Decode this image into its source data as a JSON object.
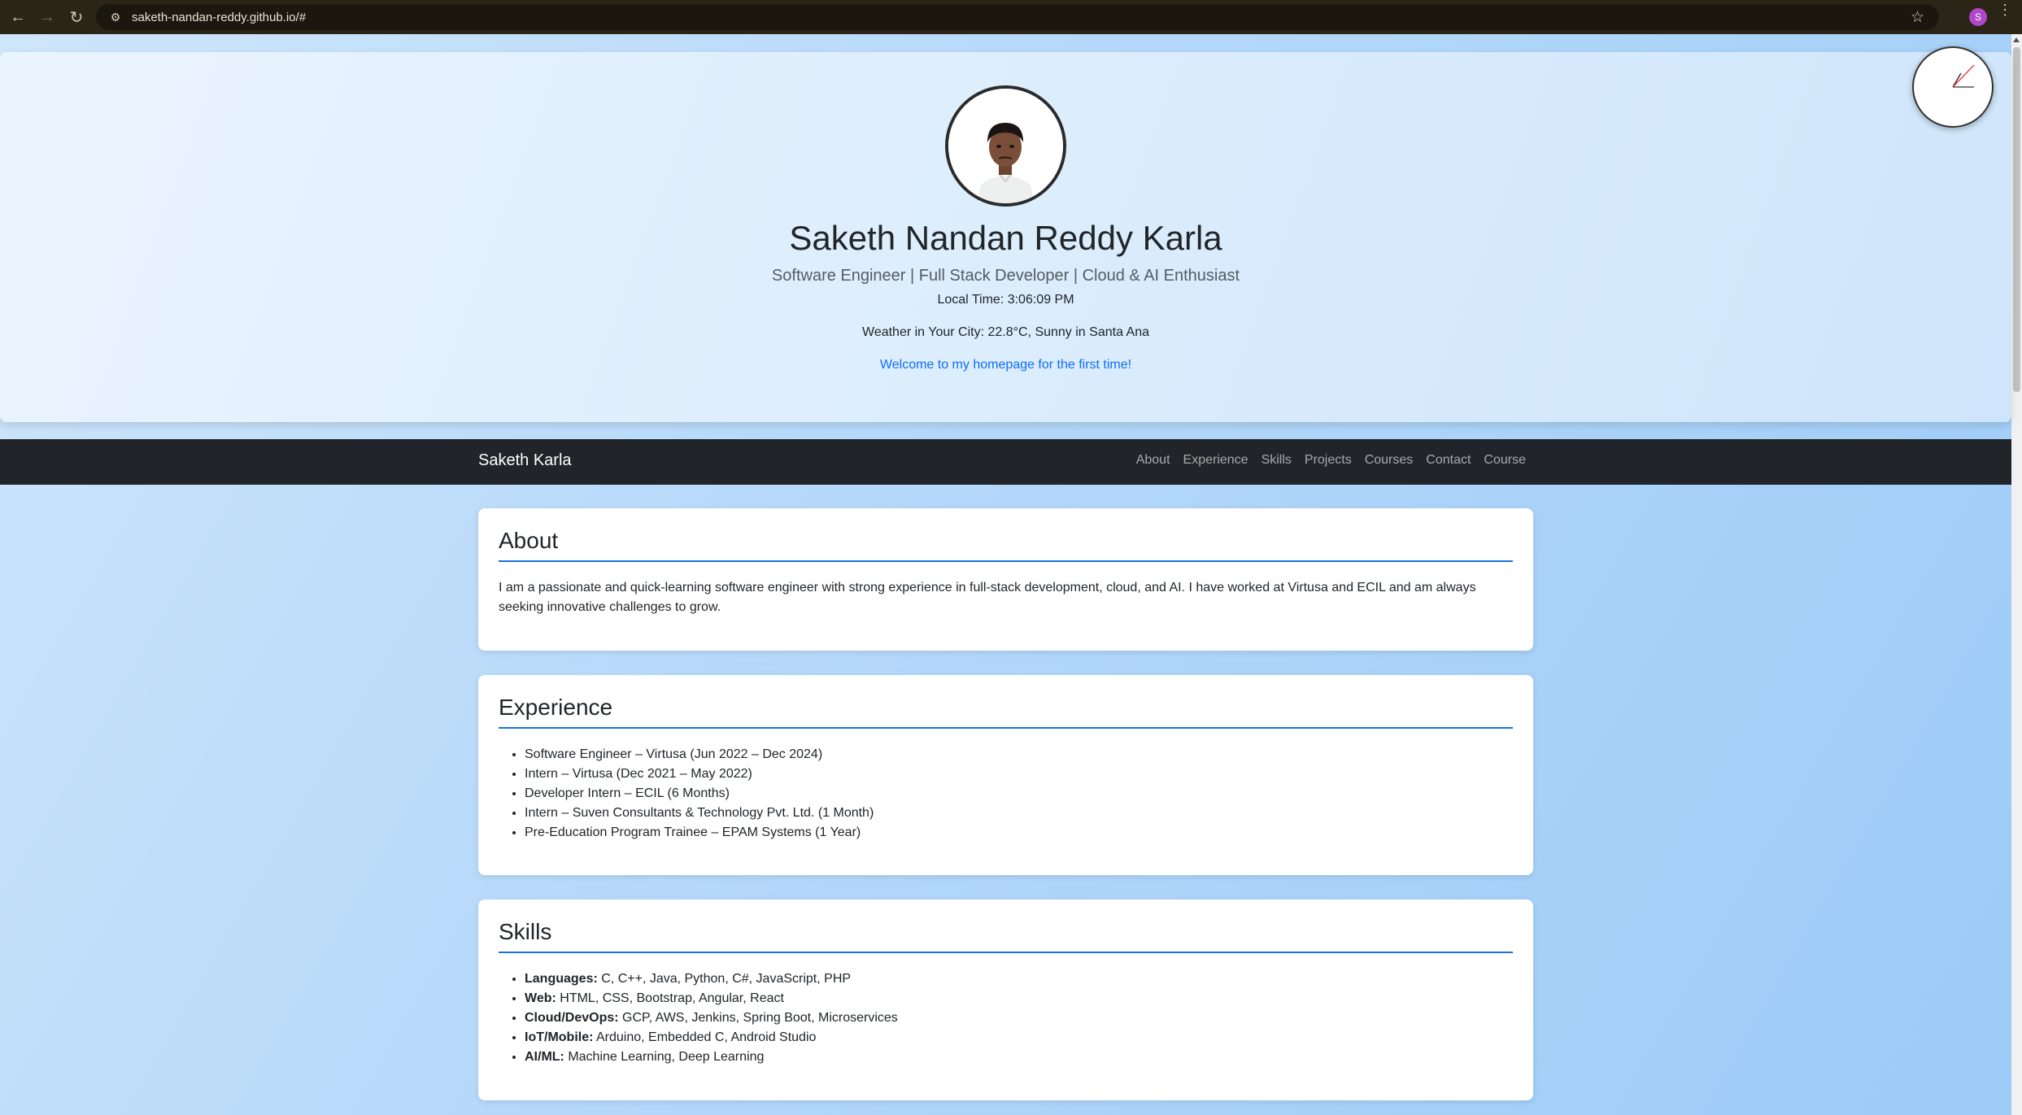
{
  "browser": {
    "url": "saketh-nandan-reddy.github.io/#",
    "profile_initial": "S"
  },
  "header": {
    "name": "Saketh Nandan Reddy Karla",
    "subtitle": "Software Engineer | Full Stack Developer | Cloud & AI Enthusiast",
    "local_time": "Local Time: 3:06:09 PM",
    "weather": "Weather in Your City: 22.8°C, Sunny in Santa Ana",
    "welcome": "Welcome to my homepage for the first time!"
  },
  "navbar": {
    "brand": "Saketh Karla",
    "links": [
      "About",
      "Experience",
      "Skills",
      "Projects",
      "Courses",
      "Contact",
      "Course"
    ]
  },
  "about": {
    "title": "About",
    "text": "I am a passionate and quick-learning software engineer with strong experience in full-stack development, cloud, and AI. I have worked at Virtusa and ECIL and am always seeking innovative challenges to grow."
  },
  "experience": {
    "title": "Experience",
    "items": [
      "Software Engineer – Virtusa (Jun 2022 – Dec 2024)",
      "Intern – Virtusa (Dec 2021 – May 2022)",
      "Developer Intern – ECIL (6 Months)",
      "Intern – Suven Consultants & Technology Pvt. Ltd. (1 Month)",
      "Pre-Education Program Trainee – EPAM Systems (1 Year)"
    ]
  },
  "skills": {
    "title": "Skills",
    "items": [
      {
        "label": "Languages:",
        "value": " C, C++, Java, Python, C#, JavaScript, PHP"
      },
      {
        "label": "Web:",
        "value": " HTML, CSS, Bootstrap, Angular, React"
      },
      {
        "label": "Cloud/DevOps:",
        "value": " GCP, AWS, Jenkins, Spring Boot, Microservices"
      },
      {
        "label": "IoT/Mobile:",
        "value": " Arduino, Embedded C, Android Studio"
      },
      {
        "label": "AI/ML:",
        "value": " Machine Learning, Deep Learning"
      }
    ]
  },
  "colors": {
    "accent": "#0d6efd",
    "navbar_bg": "#212529",
    "heading_rule": "#1a73d9"
  }
}
